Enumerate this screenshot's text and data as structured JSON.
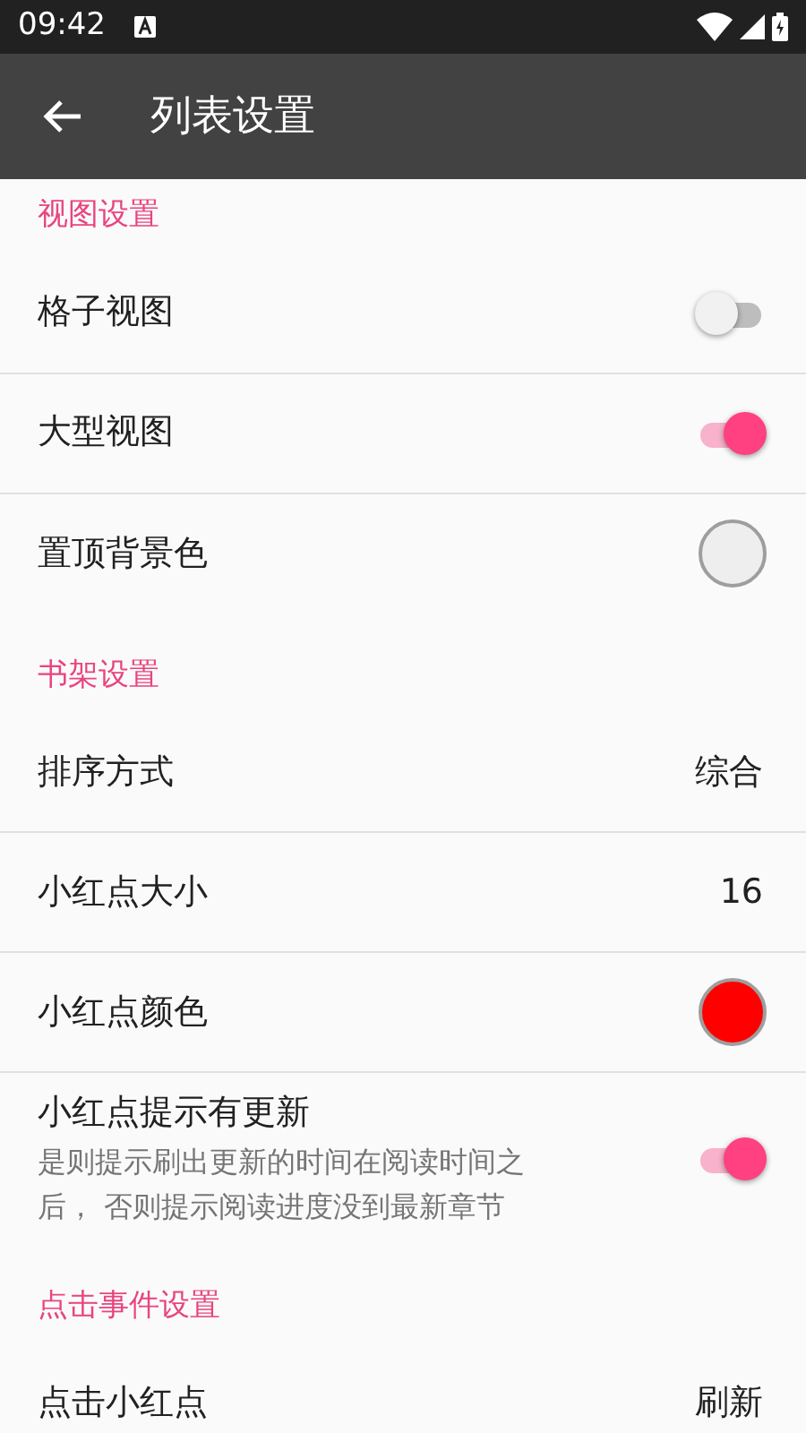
{
  "status_bar": {
    "time": "09:42"
  },
  "app_bar": {
    "title": "列表设置"
  },
  "sections": [
    {
      "title": "视图设置",
      "items": [
        {
          "kind": "switch",
          "label": "格子视图",
          "on": false
        },
        {
          "kind": "switch",
          "label": "大型视图",
          "on": true
        },
        {
          "kind": "color",
          "label": "置顶背景色",
          "color": "#eeeeee"
        }
      ]
    },
    {
      "title": "书架设置",
      "items": [
        {
          "kind": "value",
          "label": "排序方式",
          "value": "综合"
        },
        {
          "kind": "value",
          "label": "小红点大小",
          "value": "16"
        },
        {
          "kind": "color",
          "label": "小红点颜色",
          "color": "#ff0000"
        },
        {
          "kind": "switch",
          "label": "小红点提示有更新",
          "summary": "是则提示刷出更新的时间在阅读时间之后， 否则提示阅读进度没到最新章节",
          "on": true
        }
      ]
    },
    {
      "title": "点击事件设置",
      "items": [
        {
          "kind": "value",
          "label": "点击小红点",
          "value": "刷新"
        }
      ]
    }
  ]
}
